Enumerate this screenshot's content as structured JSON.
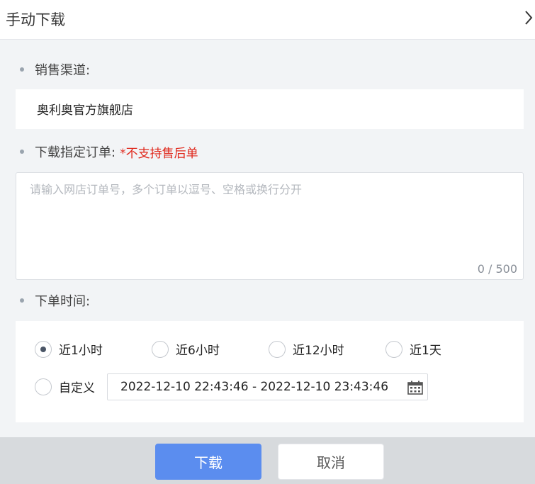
{
  "dialog": {
    "title": "手动下载"
  },
  "channel": {
    "label": "销售渠道:",
    "value": "奥利奥官方旗舰店"
  },
  "orders": {
    "label": "下载指定订单:",
    "note": "*不支持售后单",
    "placeholder": "请输入网店订单号，多个订单以逗号、空格或换行分开",
    "counter": "0 / 500"
  },
  "time": {
    "label": "下单时间:",
    "options": [
      {
        "label": "近1小时",
        "selected": true
      },
      {
        "label": "近6小时",
        "selected": false
      },
      {
        "label": "近12小时",
        "selected": false
      },
      {
        "label": "近1天",
        "selected": false
      }
    ],
    "custom_label": "自定义",
    "range": "2022-12-10 22:43:46 - 2022-12-10 23:43:46"
  },
  "footer": {
    "download_label": "下载",
    "cancel_label": "取消"
  },
  "colors": {
    "primary": "#5b8def",
    "required": "#e0271b",
    "background": "#f2f4f6"
  }
}
